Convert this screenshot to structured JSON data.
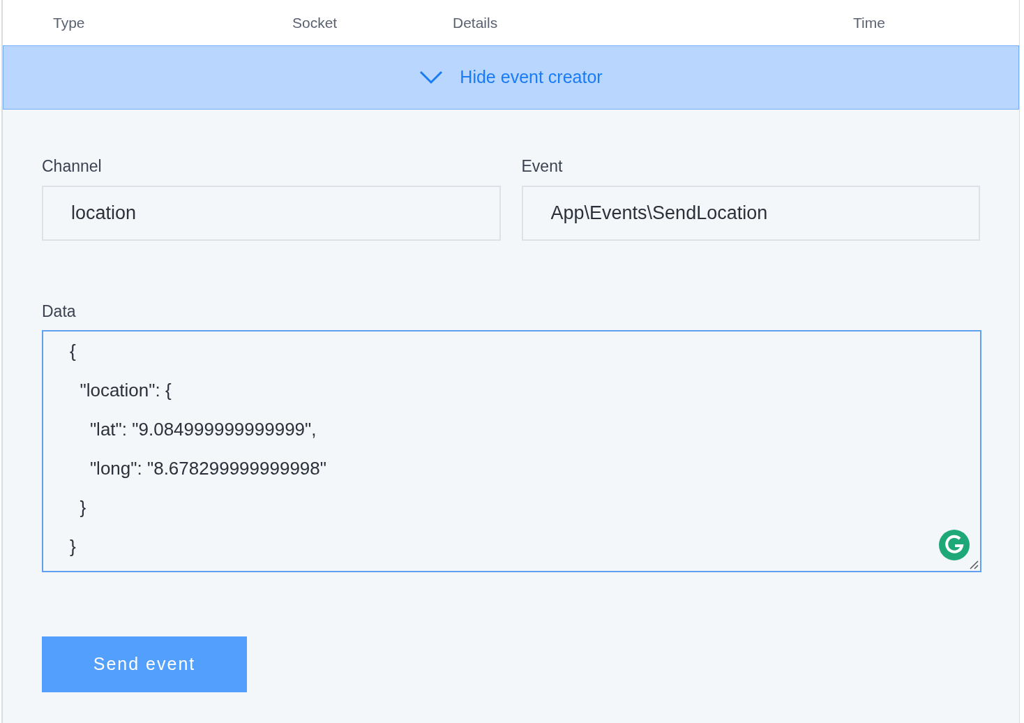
{
  "table": {
    "columns": [
      "Type",
      "Socket",
      "Details",
      "Time"
    ]
  },
  "toggle": {
    "label": "Hide event creator",
    "expanded": true
  },
  "form": {
    "channel": {
      "label": "Channel",
      "value": "location"
    },
    "event": {
      "label": "Event",
      "value": "App\\Events\\SendLocation"
    },
    "data": {
      "label": "Data",
      "value": "{\n  \"location\": {\n    \"lat\": \"9.084999999999999\",\n    \"long\": \"8.678299999999998\"\n  }\n}"
    }
  },
  "send_button": "Send event"
}
